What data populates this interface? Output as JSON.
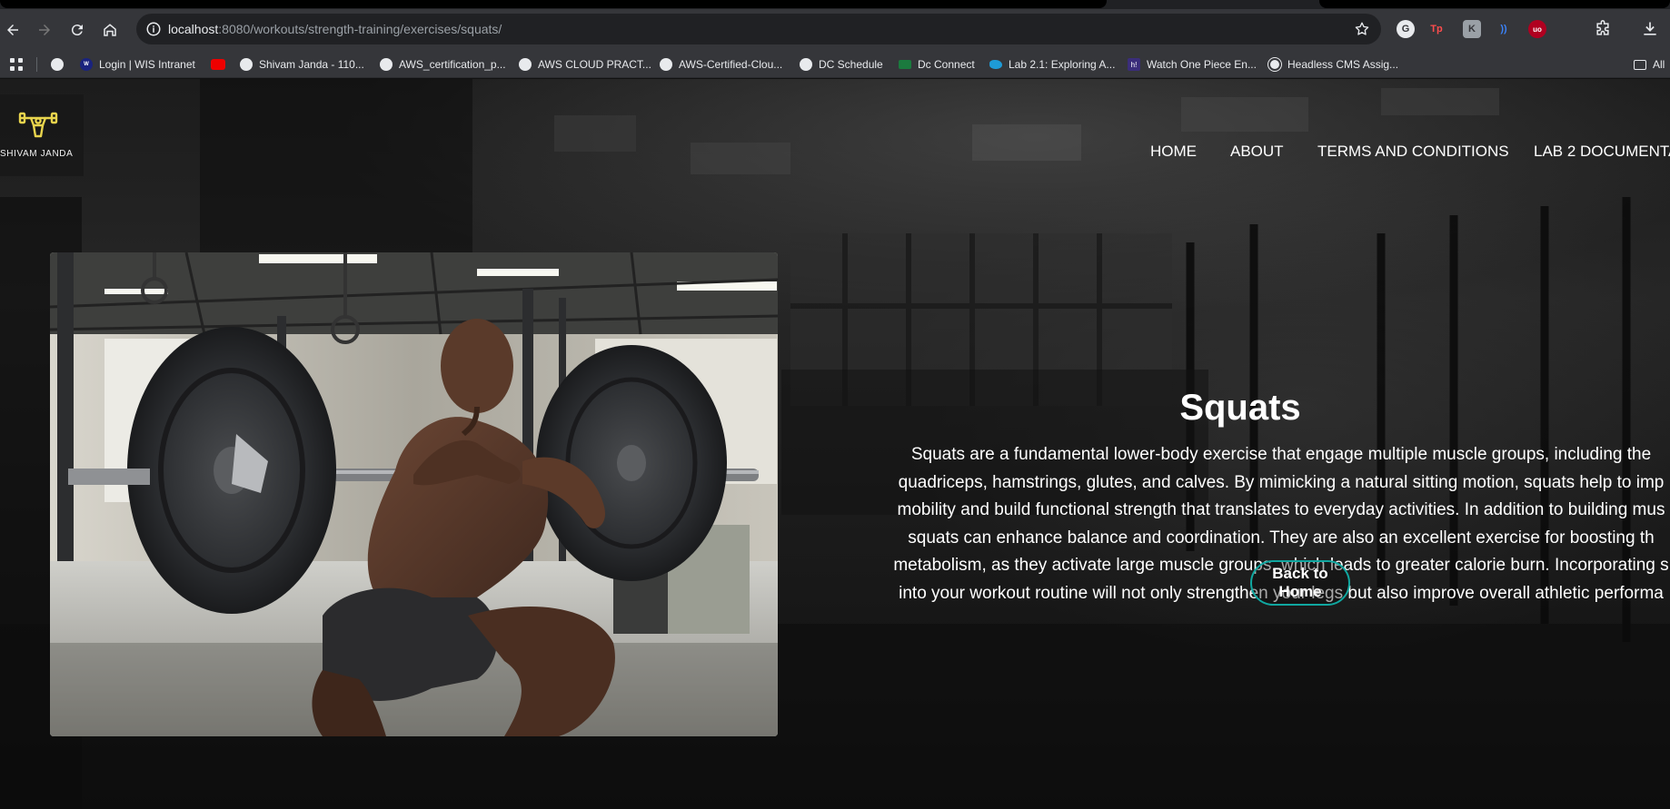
{
  "browser": {
    "url_host": "localhost",
    "url_path": ":8080/workouts/strength-training/exercises/squats/",
    "bookmarks": [
      {
        "label": "Login | WIS Intranet"
      },
      {
        "label": ""
      },
      {
        "label": "Shivam Janda - 110..."
      },
      {
        "label": "AWS_certification_p..."
      },
      {
        "label": "AWS CLOUD PRACT..."
      },
      {
        "label": "AWS-Certified-Clou..."
      },
      {
        "label": "DC  Schedule"
      },
      {
        "label": "Dc Connect"
      },
      {
        "label": "Lab 2.1: Exploring A..."
      },
      {
        "label": "Watch One Piece En..."
      },
      {
        "label": "Headless CMS Assig..."
      },
      {
        "label": "All"
      }
    ],
    "extensions": [
      "G",
      "Tp",
      "K",
      "))",
      "uo",
      "",
      ""
    ]
  },
  "site": {
    "logo_text": "SHIVAM JANDA",
    "nav": [
      "HOME",
      "ABOUT",
      "TERMS AND CONDITIONS",
      "LAB 2 DOCUMENTA"
    ]
  },
  "exercise": {
    "title": "Squats",
    "description": "Squats are a fundamental lower-body exercise that engage multiple muscle groups, including the quadriceps, hamstrings, glutes, and calves. By mimicking a natural sitting motion, squats help to imp mobility and build functional strength that translates to everyday activities. In addition to building mus squats can enhance balance and coordination. They are also an excellent exercise for boosting th metabolism, as they activate large muscle groups, which leads to greater calorie burn. Incorporating s into your workout routine will not only strengthen your legs but also improve overall athletic performa",
    "description_lines": [
      "Squats are a fundamental lower-body exercise that engage multiple muscle groups, including the",
      "quadriceps, hamstrings, glutes, and calves. By mimicking a natural sitting motion, squats help to imp",
      "mobility and build functional strength that translates to everyday activities. In addition to building mus",
      "squats can enhance balance and coordination. They are also an excellent exercise for boosting th",
      "metabolism, as they activate large muscle groups, which leads to greater calorie burn. Incorporating s",
      "into your workout routine will not only strengthen your legs but also improve overall athletic performa"
    ],
    "back_label": "Back to Home"
  },
  "colors": {
    "accent": "#10a7a0",
    "logo": "#e8d44d"
  }
}
